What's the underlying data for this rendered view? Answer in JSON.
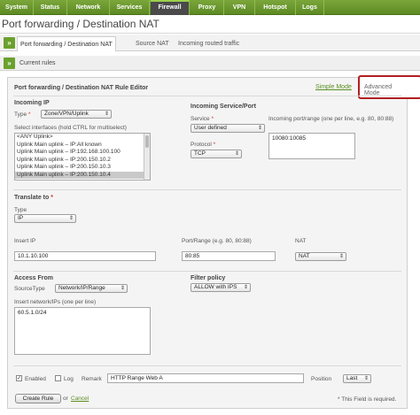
{
  "nav": {
    "items": [
      {
        "label": "System"
      },
      {
        "label": "Status"
      },
      {
        "label": "Network"
      },
      {
        "label": "Services"
      },
      {
        "label": "Firewall"
      },
      {
        "label": "Proxy"
      },
      {
        "label": "VPN"
      },
      {
        "label": "Hotspot"
      },
      {
        "label": "Logs"
      }
    ],
    "active": "Firewall"
  },
  "page": {
    "title": "Port forwarding / Destination NAT"
  },
  "tabs": [
    {
      "label": "Port forwarding / Destination NAT",
      "active": true
    },
    {
      "label": "Source NAT",
      "active": false
    },
    {
      "label": "Incoming routed traffic",
      "active": false
    }
  ],
  "current_rules": {
    "label": "Current rules"
  },
  "editor": {
    "title": "Port forwarding / Destination NAT Rule Editor",
    "simple_mode": "Simple Mode",
    "advanced_mode": "Advanced Mode",
    "incoming_ip": {
      "heading": "Incoming IP",
      "type_label": "Type",
      "required": "*",
      "type_value": "Zone/VPN/Uplink",
      "interfaces_label": "Select interfaces (hold CTRL for multiselect)",
      "interfaces": [
        {
          "label": "<ANY Uplink>",
          "selected": false
        },
        {
          "label": "Uplink Main uplink – IP:All known",
          "selected": false
        },
        {
          "label": "Uplink Main uplink – IP:192.168.100.100",
          "selected": false
        },
        {
          "label": "Uplink Main uplink – IP:200.150.10.2",
          "selected": false
        },
        {
          "label": "Uplink Main uplink – IP:200.150.10.3",
          "selected": false
        },
        {
          "label": "Uplink Main uplink – IP:200.150.10.4",
          "selected": true
        }
      ]
    },
    "incoming_service": {
      "heading": "Incoming Service/Port",
      "service_label": "Service",
      "service_value": "User defined",
      "protocol_label": "Protocol",
      "protocol_value": "TCP",
      "ports_label": "Incoming port/range (one per line, e.g. 80, 80:88)",
      "ports_value": "10080:10085"
    },
    "translate": {
      "heading": "Translate to",
      "type_label": "Type",
      "type_value": "IP",
      "insert_ip_label": "Insert IP",
      "insert_ip_value": "10.1.10.100",
      "port_label": "Port/Range (e.g. 80, 80:88)",
      "port_value": "80:85",
      "nat_label": "NAT",
      "nat_value": "NAT"
    },
    "access_from": {
      "heading": "Access From",
      "source_type_label": "SourceType",
      "source_type_value": "Network/IP/Range",
      "networks_label": "Insert network/IPs (one per line)",
      "networks_value": "60.5.1.0/24"
    },
    "filter_policy": {
      "heading": "Filter policy",
      "value": "ALLOW with IPS"
    },
    "footer": {
      "enabled_label": "Enabled",
      "enabled_checked": true,
      "log_label": "Log",
      "log_checked": false,
      "remark_label": "Remark",
      "remark_value": "HTTP Range Web A",
      "position_label": "Position",
      "position_value": "Last",
      "create_button": "Create Rule",
      "or_text": "or",
      "cancel_link": "Cancel",
      "required_note": "* This Field is required."
    }
  }
}
